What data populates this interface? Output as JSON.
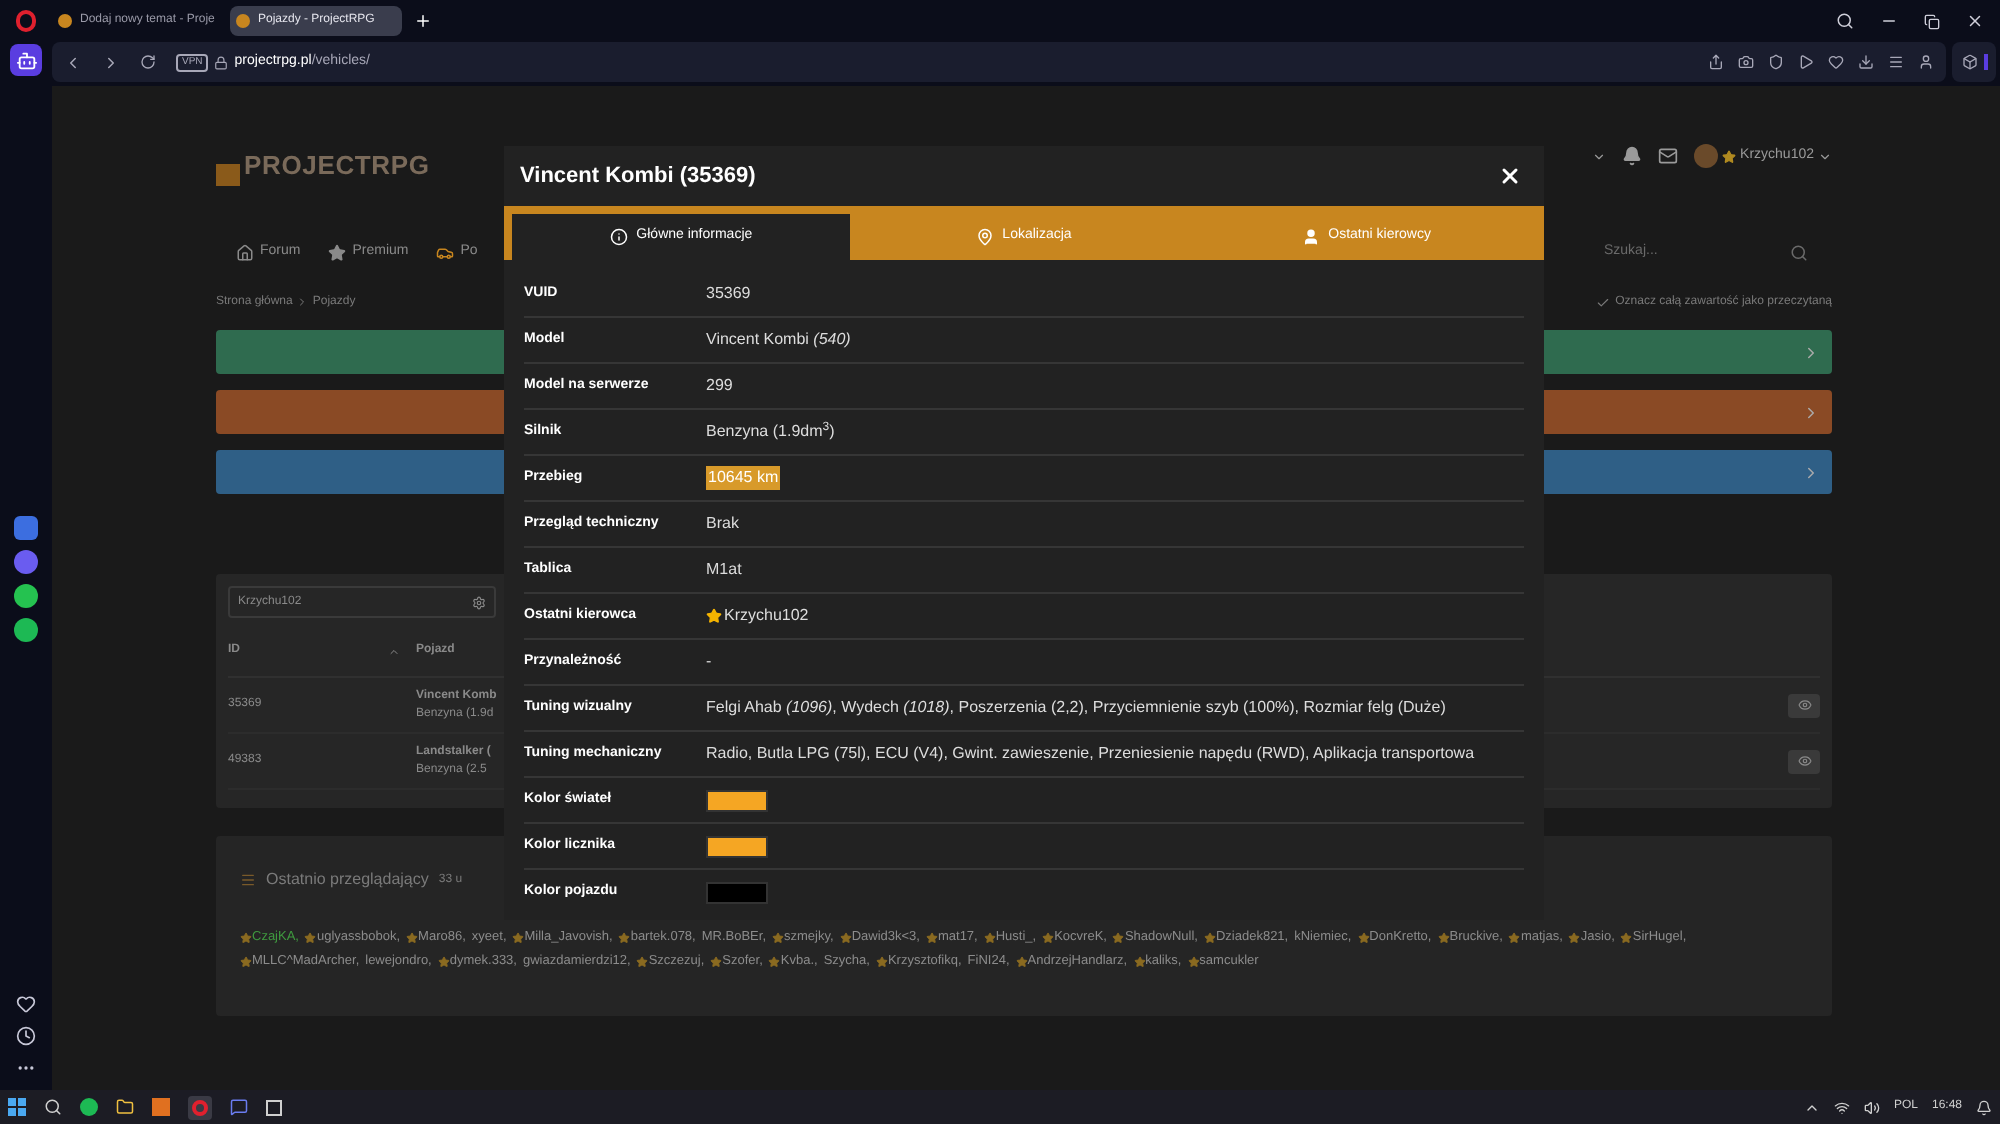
{
  "browser": {
    "tabs": [
      {
        "title": "Dodaj nowy temat - Proje",
        "selected": false
      },
      {
        "title": "Pojazdy - ProjectRPG",
        "selected": true
      }
    ],
    "vpn": "VPN",
    "url_host": "projectrpg.pl",
    "url_path": "/vehicles/"
  },
  "site": {
    "logo": "PROJECTRPG",
    "user": "Krzychu102",
    "nav": [
      {
        "label": "Forum",
        "kind": "home"
      },
      {
        "label": "Premium",
        "kind": "star"
      },
      {
        "label": "Po",
        "kind": "car"
      }
    ],
    "search": {
      "placeholder": "Szukaj..."
    },
    "breadcrumb": [
      "Strona główna",
      "Pojazdy"
    ],
    "mark_read": "Oznacz całą zawartość jako przeczytaną",
    "bars": [
      {
        "color": "#2f6b4f"
      },
      {
        "color": "#8a4a25"
      },
      {
        "color": "#2f5f86"
      }
    ],
    "table": {
      "filter": "Krzychu102",
      "columns": [
        "ID",
        "Pojazd"
      ],
      "rows": [
        {
          "id": "35369",
          "name": "Vincent Komb",
          "engine": "Benzyna (1.9d"
        },
        {
          "id": "49383",
          "name": "Landstalker (",
          "engine": "Benzyna (2.5"
        }
      ]
    },
    "viewers": {
      "title": "Ostatnio przeglądający",
      "count": "33 u",
      "names": [
        {
          "name": "CzajKA,",
          "star": true,
          "color": "#3f9a3f"
        },
        {
          "name": "uglyassbobok,",
          "star": true,
          "color": "#8c8c8c"
        },
        {
          "name": "Maro86,",
          "star": true,
          "color": "#8c8c8c"
        },
        {
          "name": "xyeet,",
          "star": false,
          "color": "#8c8c8c"
        },
        {
          "name": "Milla_Javovish,",
          "star": true,
          "color": "#8c8c8c"
        },
        {
          "name": "bartek.078,",
          "star": true,
          "color": "#8c8c8c"
        },
        {
          "name": "MR.BoBEr,",
          "star": false,
          "color": "#8c8c8c"
        },
        {
          "name": "szmejky,",
          "star": true,
          "color": "#8c8c8c"
        },
        {
          "name": "Dawid3k<3,",
          "star": true,
          "color": "#8c8c8c"
        },
        {
          "name": "mat17,",
          "star": true,
          "color": "#8c8c8c"
        },
        {
          "name": "Husti_,",
          "star": true,
          "color": "#8c8c8c"
        },
        {
          "name": "KocvreK,",
          "star": true,
          "color": "#8c8c8c"
        },
        {
          "name": "ShadowNull,",
          "star": true,
          "color": "#8c8c8c"
        },
        {
          "name": "Dziadek821,",
          "star": true,
          "color": "#8c8c8c"
        },
        {
          "name": "kNiemiec,",
          "star": false,
          "color": "#8c8c8c"
        },
        {
          "name": "DonKretto,",
          "star": true,
          "color": "#8c8c8c"
        },
        {
          "name": "Bruckive,",
          "star": true,
          "color": "#8c8c8c"
        },
        {
          "name": "matjas,",
          "star": true,
          "color": "#8c8c8c"
        },
        {
          "name": "Jasio,",
          "star": true,
          "color": "#8c8c8c"
        },
        {
          "name": "SirHugel,",
          "star": true,
          "color": "#8c8c8c"
        },
        {
          "name": "MLLC^MadArcher,",
          "star": true,
          "color": "#8c8c8c"
        },
        {
          "name": "lewejondro,",
          "star": false,
          "color": "#8c8c8c"
        },
        {
          "name": "dymek.333,",
          "star": true,
          "color": "#8c8c8c"
        },
        {
          "name": "gwiazdamierdzi12,",
          "star": false,
          "color": "#8c8c8c"
        },
        {
          "name": "Szczezuj,",
          "star": true,
          "color": "#8c8c8c"
        },
        {
          "name": "Szofer,",
          "star": true,
          "color": "#8c8c8c"
        },
        {
          "name": "Kvba.,",
          "star": true,
          "color": "#8c8c8c"
        },
        {
          "name": "Szycha,",
          "star": false,
          "color": "#8c8c8c"
        },
        {
          "name": "Krzysztofikq,",
          "star": true,
          "color": "#8c8c8c"
        },
        {
          "name": "FiNI24,",
          "star": false,
          "color": "#8c8c8c"
        },
        {
          "name": "AndrzejHandlarz,",
          "star": true,
          "color": "#8c8c8c"
        },
        {
          "name": "kaliks,",
          "star": true,
          "color": "#8c8c8c"
        },
        {
          "name": "samcukler",
          "star": true,
          "color": "#8c8c8c"
        }
      ]
    }
  },
  "modal": {
    "title": "Vincent Kombi (35369)",
    "tabs": [
      {
        "label": "Główne informacje",
        "kind": "info",
        "selected": true
      },
      {
        "label": "Lokalizacja",
        "kind": "pin",
        "selected": false
      },
      {
        "label": "Ostatni kierowcy",
        "kind": "user",
        "selected": false
      }
    ],
    "rows": [
      {
        "label": "VUID",
        "kind": "text",
        "value": "35369"
      },
      {
        "label": "Model",
        "kind": "text",
        "value": "Vincent Kombi *(540)*"
      },
      {
        "label": "Model na serwerze",
        "kind": "text",
        "value": "299"
      },
      {
        "label": "Silnik",
        "kind": "text",
        "value": "Benzyna (1.9dm$^{3}$)"
      },
      {
        "label": "Przebieg",
        "kind": "highlight",
        "value": "10645 km"
      },
      {
        "label": "Przegląd techniczny",
        "kind": "text",
        "value": "Brak"
      },
      {
        "label": "Tablica",
        "kind": "text",
        "value": "M1at"
      },
      {
        "label": "Ostatni kierowca",
        "kind": "driver",
        "value": "Krzychu102"
      },
      {
        "label": "Przynależność",
        "kind": "text",
        "value": "-"
      },
      {
        "label": "Tuning wizualny",
        "kind": "text",
        "value": "Felgi Ahab *(1096)*, Wydech *(1018)*, Poszerzenia (2,2), Przyciemnienie szyb (100%), Rozmiar felg (Duże)"
      },
      {
        "label": "Tuning mechaniczny",
        "kind": "text",
        "value": "Radio, Butla LPG (75l), ECU (V4), Gwint. zawieszenie, Przeniesienie napędu (RWD), Aplikacja transportowa"
      },
      {
        "label": "Kolor świateł",
        "kind": "color",
        "color": "#f5a623"
      },
      {
        "label": "Kolor licznika",
        "kind": "color",
        "color": "#f5a623"
      },
      {
        "label": "Kolor pojazdu",
        "kind": "color",
        "color": "#000000"
      }
    ]
  },
  "taskbar": {
    "language": "POL",
    "time": "16:48"
  }
}
